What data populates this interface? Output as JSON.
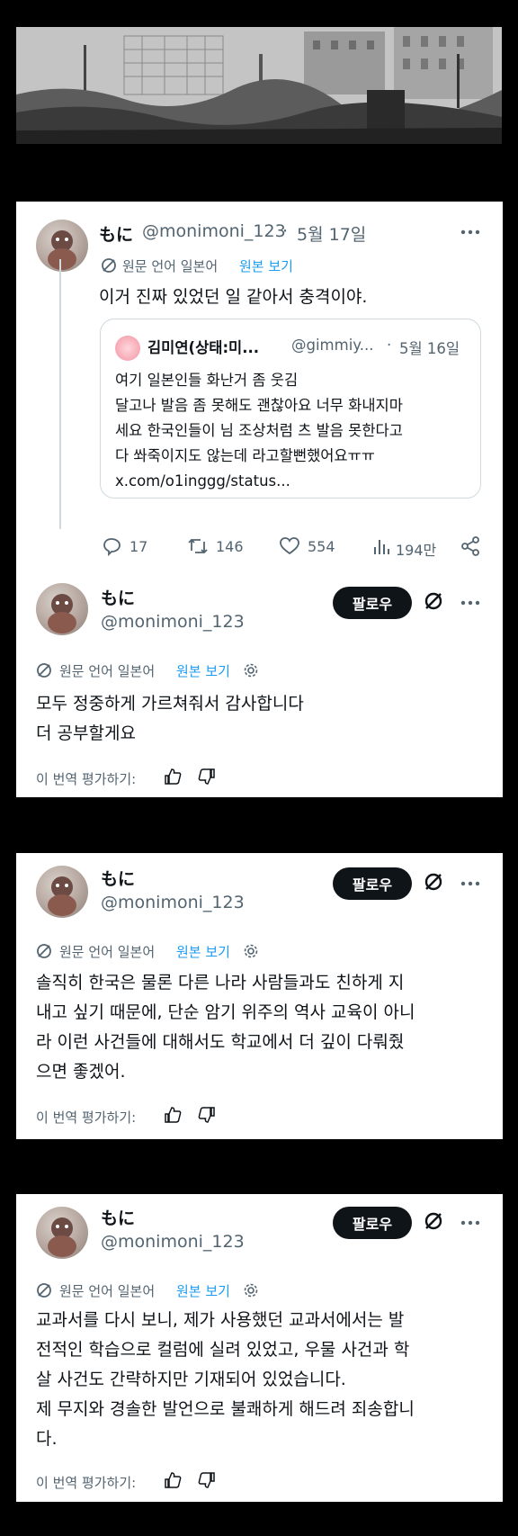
{
  "tweet": {
    "display_name": "もに",
    "handle": "@monimoni_123",
    "date": "5월 17일",
    "translated_from": "원문 언어 일본어",
    "view_original": "원본 보기",
    "text": "이거 진짜 있었던 일 같아서 충격이야.",
    "quote": {
      "display_name": "김미연(상태:미...",
      "handle": "@gimmiy...",
      "date": "5월 16일",
      "lines": [
        "여기 일본인들 화난거 좀 웃김",
        "달고나 발음 좀 못해도 괜찮아요 너무 화내지마",
        "세요 한국인들이 님 조상처럼 츠 발음 못한다고",
        "다 쏴죽이지도 않는데 라고할뻔했어요ㅠㅠ",
        "x.com/o1inggg/status..."
      ]
    },
    "stats": {
      "replies": "17",
      "retweets": "146",
      "likes": "554",
      "views": "194만"
    }
  },
  "replies": [
    {
      "display_name": "もに",
      "handle": "@monimoni_123",
      "follow_label": "팔로우",
      "translated_from": "원문 언어 일본어",
      "view_original": "원본 보기",
      "lines": [
        "모두 정중하게 가르쳐줘서 감사합니다",
        "더 공부할게요"
      ],
      "rate_label": "이 번역 평가하기:"
    },
    {
      "display_name": "もに",
      "handle": "@monimoni_123",
      "follow_label": "팔로우",
      "translated_from": "원문 언어 일본어",
      "view_original": "원본 보기",
      "lines": [
        "솔직히 한국은 물론 다른 나라 사람들과도 친하게 지",
        "내고 싶기 때문에, 단순 암기 위주의 역사 교육이 아니",
        "라 이런 사건들에 대해서도 학교에서 더 깊이 다뤄줬",
        "으면 좋겠어."
      ],
      "rate_label": "이 번역 평가하기:"
    },
    {
      "display_name": "もに",
      "handle": "@monimoni_123",
      "follow_label": "팔로우",
      "translated_from": "원문 언어 일본어",
      "view_original": "원본 보기",
      "lines": [
        "교과서를 다시 보니, 제가 사용했던 교과서에서는 발",
        "전적인 학습으로 컬럼에 실려 있었고, 우물 사건과 학",
        "살 사건도 간략하지만 기재되어 있었습니다.",
        "제 무지와 경솔한 발언으로 불쾌하게 해드려 죄송합니",
        "다."
      ],
      "rate_label": "이 번역 평가하기:"
    }
  ],
  "colors": {
    "accent": "#1d9bf0",
    "text": "#0f1419",
    "muted": "#536471",
    "follow_bg": "#0f1419"
  },
  "icons": [
    "more-icon",
    "translate-icon",
    "gear-icon",
    "reply-icon",
    "retweet-icon",
    "like-icon",
    "views-icon",
    "share-icon",
    "grok-icon",
    "thumbs-up-icon",
    "thumbs-down-icon"
  ]
}
